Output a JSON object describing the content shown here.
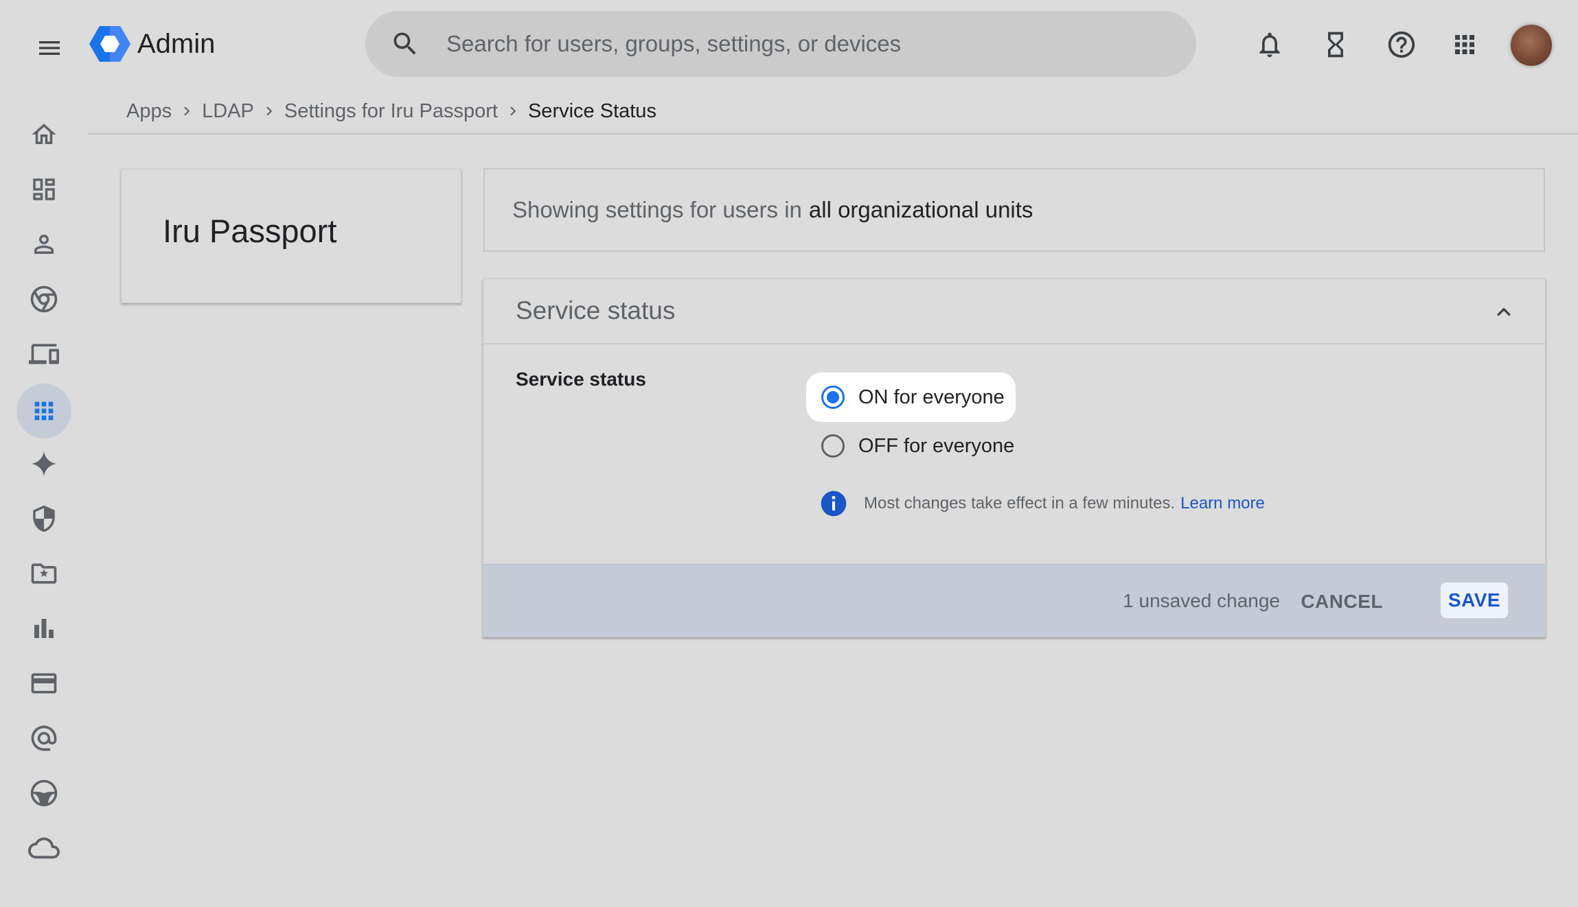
{
  "header": {
    "app_title": "Admin",
    "search_placeholder": "Search for users, groups, settings, or devices"
  },
  "icons": {
    "menu": "menu-icon",
    "logo": "admin-logo-icon",
    "search": "search-icon",
    "notifications": "bell-icon",
    "tasks": "hourglass-icon",
    "help": "help-icon",
    "apps": "apps-grid-icon",
    "avatar": "account-avatar"
  },
  "sidebar": {
    "items": [
      {
        "name": "home",
        "icon": "home-icon"
      },
      {
        "name": "dashboard",
        "icon": "dashboard-icon"
      },
      {
        "name": "directory",
        "icon": "person-icon"
      },
      {
        "name": "chrome-browser",
        "icon": "chrome-icon"
      },
      {
        "name": "devices",
        "icon": "devices-icon"
      },
      {
        "name": "apps",
        "icon": "apps-dots-icon",
        "active": true
      },
      {
        "name": "generative-ai",
        "icon": "sparkle-icon"
      },
      {
        "name": "security",
        "icon": "shield-icon"
      },
      {
        "name": "data",
        "icon": "folder-star-icon"
      },
      {
        "name": "reporting",
        "icon": "bar-chart-icon"
      },
      {
        "name": "billing",
        "icon": "credit-card-icon"
      },
      {
        "name": "account",
        "icon": "at-sign-icon"
      },
      {
        "name": "rules",
        "icon": "steering-wheel-icon"
      },
      {
        "name": "storage",
        "icon": "cloud-icon"
      }
    ]
  },
  "breadcrumb": {
    "items": [
      "Apps",
      "LDAP",
      "Settings for Iru Passport"
    ],
    "current": "Service Status"
  },
  "app_card": {
    "name": "Iru Passport"
  },
  "ou_banner": {
    "prefix": "Showing settings for users in",
    "ou": "all organizational units"
  },
  "panel": {
    "title": "Service status",
    "setting_label": "Service status",
    "options": [
      {
        "label": "ON for everyone",
        "selected": true
      },
      {
        "label": "OFF for everyone",
        "selected": false
      }
    ],
    "info_text": "Most changes take effect in a few minutes.",
    "info_link": "Learn more",
    "footer": {
      "unsaved": "1 unsaved change",
      "cancel": "CANCEL",
      "save": "SAVE"
    }
  },
  "colors": {
    "accent": "#1a73e8",
    "link": "#1a56c7",
    "background": "#dcdcdc",
    "footer_bg": "#c5cbd6",
    "active_rail": "#c5ccd8"
  }
}
